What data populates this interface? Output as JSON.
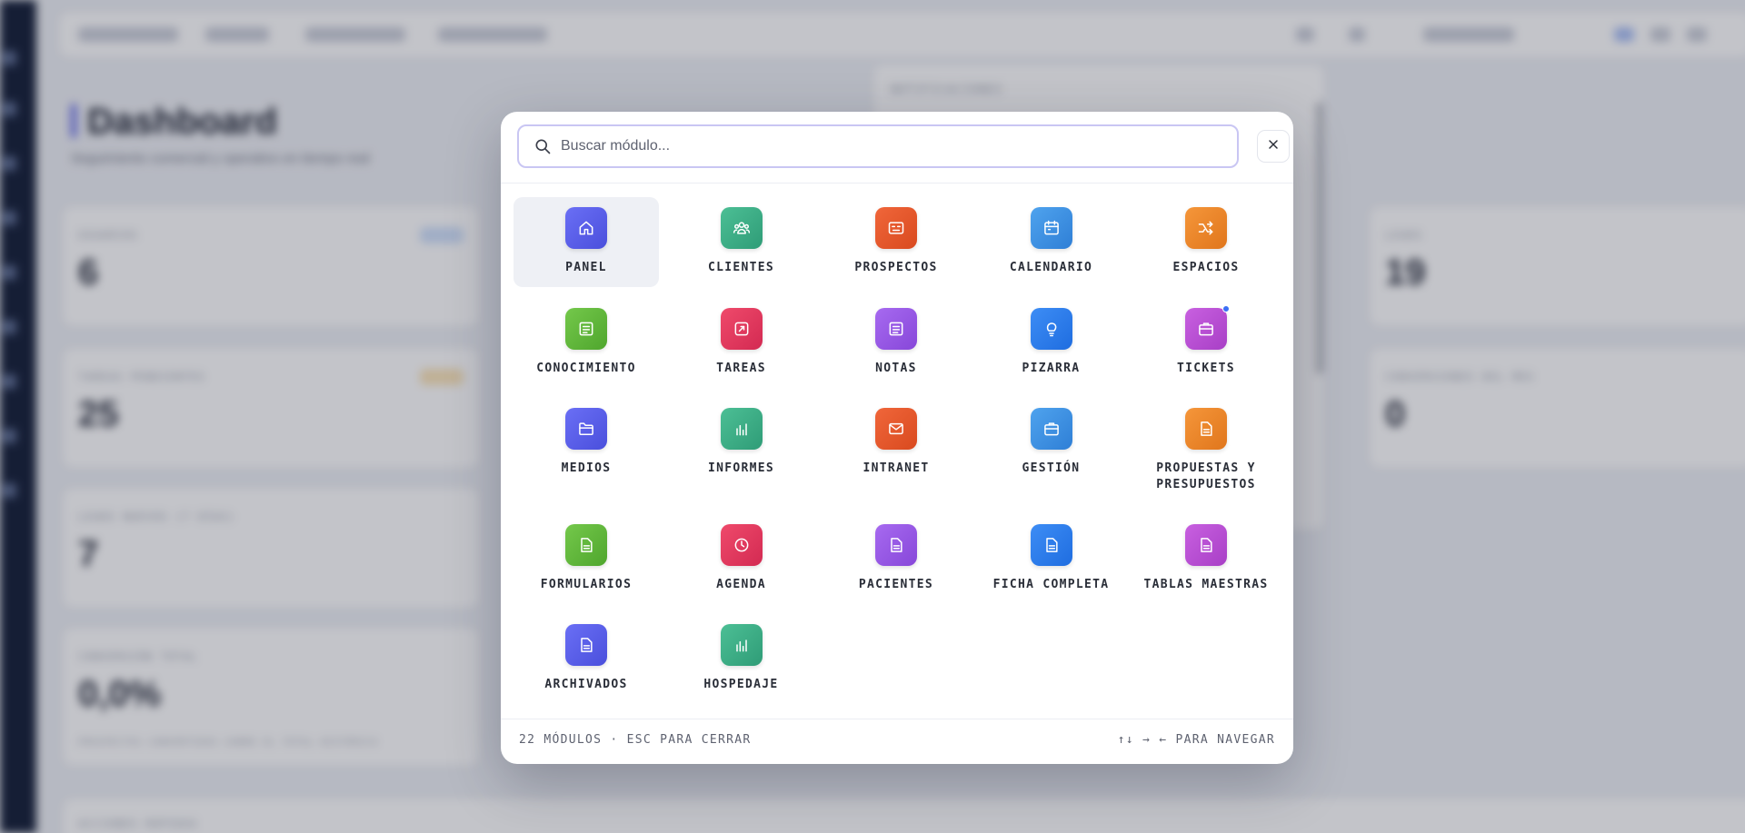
{
  "background": {
    "title": "Dashboard",
    "subtitle": "Seguimiento comercial y operativo en tiempo real",
    "cards": [
      {
        "label": "USUARIOS",
        "value": "6"
      },
      {
        "label": "LEADS",
        "value": "19"
      },
      {
        "label": "TAREAS PENDIENTES",
        "value": "25"
      },
      {
        "label": "CONVERSIONES DEL MES",
        "value": "0"
      },
      {
        "label": "LEADS NUEVOS (7 DÍAS)",
        "value": "7"
      },
      {
        "label": "CONVERSIÓN TOTAL",
        "value": "0,0%",
        "note": "PROSPECTOS CONVERTIDOS SOBRE EL TOTAL HISTÓRICO"
      },
      {
        "label": "ACCIONES RÁPIDAS",
        "value": ""
      }
    ],
    "notifications_title": "NOTIFICACIONES"
  },
  "modal": {
    "search": {
      "placeholder": "Buscar módulo...",
      "value": ""
    },
    "close_icon": "close-icon",
    "modules": [
      {
        "label": "PANEL",
        "icon": "home-icon",
        "color1": "#6a6ff5",
        "color2": "#4a4fdc",
        "active": true
      },
      {
        "label": "CLIENTES",
        "icon": "users-icon",
        "color1": "#4cbf95",
        "color2": "#2f9c77"
      },
      {
        "label": "PROSPECTOS",
        "icon": "id-card-icon",
        "color1": "#f0663a",
        "color2": "#d94a1f"
      },
      {
        "label": "CALENDARIO",
        "icon": "calendar-icon",
        "color1": "#4fa3ee",
        "color2": "#2f7fd6"
      },
      {
        "label": "ESPACIOS",
        "icon": "shuffle-icon",
        "color1": "#f5963a",
        "color2": "#e0761c"
      },
      {
        "label": "CONOCIMIENTO",
        "icon": "document-icon",
        "color1": "#74c84b",
        "color2": "#4fa62d"
      },
      {
        "label": "TAREAS",
        "icon": "external-link-icon",
        "color1": "#ef4a6b",
        "color2": "#d32a52"
      },
      {
        "label": "NOTAS",
        "icon": "notes-icon",
        "color1": "#a76af0",
        "color2": "#8747d9"
      },
      {
        "label": "PIZARRA",
        "icon": "lightbulb-icon",
        "color1": "#3d8df5",
        "color2": "#1f6de0"
      },
      {
        "label": "TICKETS",
        "icon": "briefcase-icon",
        "color1": "#c860e0",
        "color2": "#a83fc6",
        "badge": true
      },
      {
        "label": "MEDIOS",
        "icon": "folder-icon",
        "color1": "#6a6ff5",
        "color2": "#4a4fdc"
      },
      {
        "label": "INFORMES",
        "icon": "bar-chart-icon",
        "color1": "#4cbf95",
        "color2": "#2f9c77"
      },
      {
        "label": "INTRANET",
        "icon": "mail-icon",
        "color1": "#f0663a",
        "color2": "#d94a1f"
      },
      {
        "label": "GESTIÓN",
        "icon": "briefcase-icon",
        "color1": "#4fa3ee",
        "color2": "#2f7fd6"
      },
      {
        "label": "PROPUESTAS Y PRESUPUESTOS",
        "icon": "file-icon",
        "color1": "#f5963a",
        "color2": "#e0761c"
      },
      {
        "label": "FORMULARIOS",
        "icon": "file-icon",
        "color1": "#74c84b",
        "color2": "#4fa62d"
      },
      {
        "label": "AGENDA",
        "icon": "clock-icon",
        "color1": "#ef4a6b",
        "color2": "#d32a52"
      },
      {
        "label": "PACIENTES",
        "icon": "file-icon",
        "color1": "#a76af0",
        "color2": "#8747d9"
      },
      {
        "label": "FICHA COMPLETA",
        "icon": "file-icon",
        "color1": "#3d8df5",
        "color2": "#1f6de0"
      },
      {
        "label": "TABLAS MAESTRAS",
        "icon": "file-icon",
        "color1": "#c860e0",
        "color2": "#a83fc6"
      },
      {
        "label": "ARCHIVADOS",
        "icon": "file-icon",
        "color1": "#6a6ff5",
        "color2": "#4a4fdc"
      },
      {
        "label": "HOSPEDAJE",
        "icon": "bar-chart-icon",
        "color1": "#4cbf95",
        "color2": "#2f9c77"
      }
    ],
    "footer": {
      "left": "22 MÓDULOS · ESC PARA CERRAR",
      "right": "↑↓ → ← PARA NAVEGAR"
    }
  }
}
